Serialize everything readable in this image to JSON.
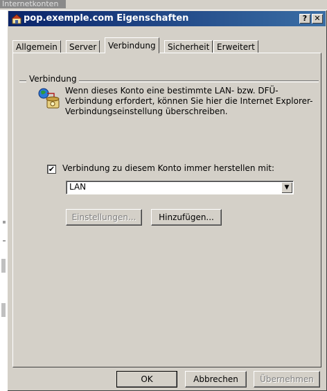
{
  "background_window": {
    "title": "Internetkonten"
  },
  "dialog": {
    "title": "pop.exemple.com Eigenschaften",
    "help_label": "?",
    "close_label": "✕"
  },
  "tabs": [
    {
      "label": "Allgemein",
      "active": false
    },
    {
      "label": "Server",
      "active": false
    },
    {
      "label": "Verbindung",
      "active": true
    },
    {
      "label": "Sicherheit",
      "active": false
    },
    {
      "label": "Erweitert",
      "active": false
    }
  ],
  "connection": {
    "group_label": "Verbindung",
    "info_text": "Wenn dieses Konto eine bestimmte LAN- bzw. DFÜ-Verbindung erfordert, können Sie hier die Internet Explorer-Verbindungseinstellung überschreiben.",
    "checkbox_label": "Verbindung zu diesem Konto immer herstellen mit:",
    "checkbox_checked": true,
    "checkbox_mark": "✔",
    "select_value": "LAN",
    "settings_label": "Einstellungen...",
    "add_label": "Hinzufügen..."
  },
  "footer": {
    "ok_label": "OK",
    "cancel_label": "Abbrechen",
    "apply_label": "Übernehmen"
  },
  "colors": {
    "dialog_bg": "#d4d0c8",
    "title_start": "#0a246a",
    "title_end": "#3a6ea5"
  }
}
